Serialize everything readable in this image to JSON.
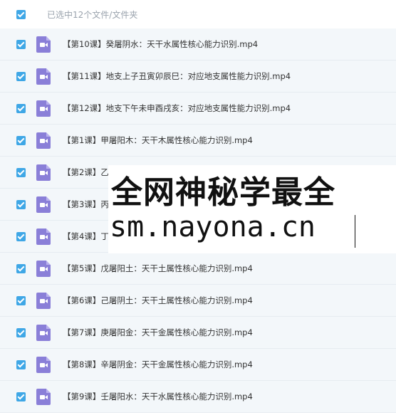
{
  "header": {
    "selection_text": "已选中12个文件/文件夹"
  },
  "files": [
    "【第10课】癸屠阴水：天干水属性核心能力识别.mp4",
    "【第11课】地支上子丑寅卯辰巳：对应地支属性能力识别.mp4",
    "【第12课】地支下午未申酉戌亥：对应地支属性能力识别.mp4",
    "【第1课】甲屠阳木：天干木属性核心能力识别.mp4",
    "【第2课】乙",
    "【第3课】丙",
    "【第4课】丁",
    "【第5课】戊屠阳土：天干土属性核心能力识别.mp4",
    "【第6课】己屠阴土：天干土属性核心能力识别.mp4",
    "【第7课】庚屠阳金：天干金属性核心能力识别.mp4",
    "【第8课】辛屠阴金：天干金属性核心能力识别.mp4",
    "【第9课】壬屠阳水：天干水属性核心能力识别.mp4"
  ],
  "watermark": {
    "line1": "全网神秘学最全",
    "line2": "sm.nayona.cn"
  }
}
